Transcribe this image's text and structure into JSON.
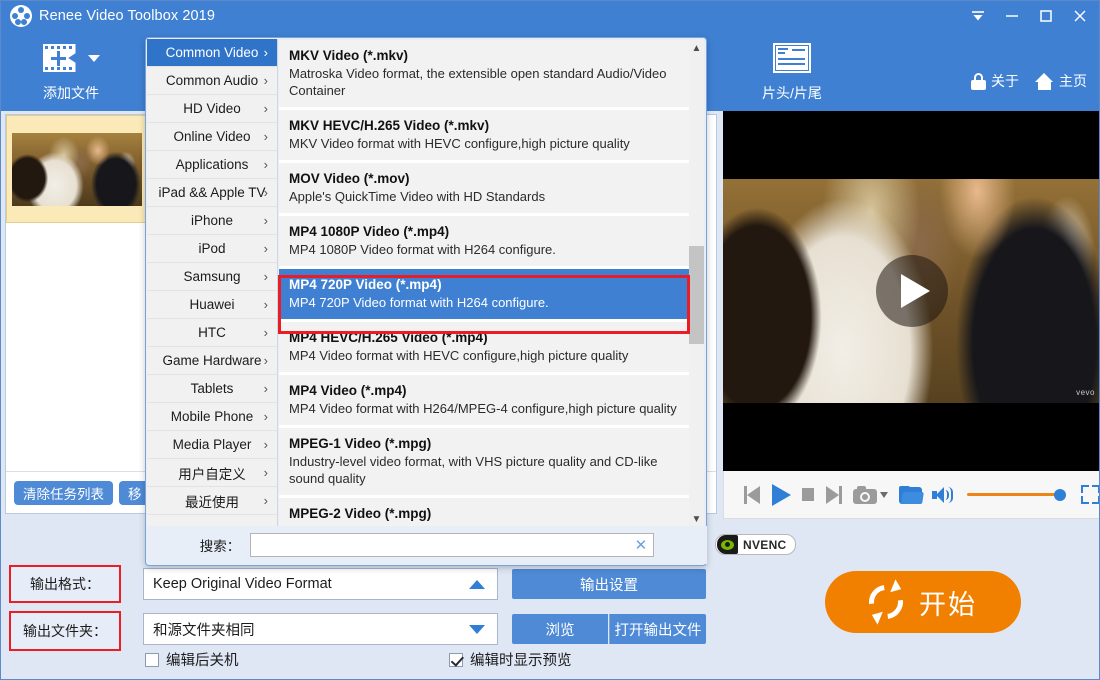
{
  "window": {
    "title": "Renee Video Toolbox 2019",
    "logo_icon": "film-reel-icon",
    "controls": [
      {
        "name": "minimize-to-tray-button",
        "glyph": "tray"
      },
      {
        "name": "minimize-button",
        "glyph": "minimize"
      },
      {
        "name": "maximize-button",
        "glyph": "maximize"
      },
      {
        "name": "close-button",
        "glyph": "close"
      }
    ]
  },
  "toolbar": {
    "add_file_label": "添加文件",
    "add_file_icon": "add-film-icon",
    "trim_label": "片头/片尾",
    "trim_icon": "head-tail-icon",
    "about_label": "关于",
    "about_icon": "lock-icon",
    "home_label": "主页",
    "home_icon": "home-icon"
  },
  "file_list": {
    "clear_button": "清除任务列表",
    "remove_button": "移",
    "items": [
      {
        "name": "wedding-video-thumbnail",
        "selected": true
      }
    ]
  },
  "preview": {
    "play_icon": "play-overlay-icon",
    "watermark": "vevo",
    "controls": [
      {
        "name": "previous-button",
        "icon": "skip-previous-icon"
      },
      {
        "name": "play-button",
        "icon": "play-icon"
      },
      {
        "name": "stop-button",
        "icon": "stop-icon"
      },
      {
        "name": "next-button",
        "icon": "skip-next-icon"
      },
      {
        "name": "snapshot-button",
        "icon": "camera-icon"
      },
      {
        "name": "snapshot-dropdown",
        "icon": "chevron-down-icon"
      },
      {
        "name": "open-folder-button",
        "icon": "folder-icon"
      },
      {
        "name": "volume-button",
        "icon": "speaker-icon"
      },
      {
        "name": "volume-slider",
        "icon": "slider-icon"
      },
      {
        "name": "fullscreen-button",
        "icon": "expand-icon"
      }
    ],
    "volume_percent": 100
  },
  "nvenc": {
    "label": "NVENC",
    "logo_icon": "nvidia-eye-icon"
  },
  "settings": {
    "output_format_label": "输出格式：",
    "output_format_value": "Keep Original Video Format",
    "output_format_caret": "up",
    "output_settings_button": "输出设置",
    "output_folder_label": "输出文件夹：",
    "output_folder_value": "和源文件夹相同",
    "output_folder_caret": "down",
    "browse_button": "浏览",
    "open_output_button": "打开输出文件",
    "shutdown_checkbox_label": "编辑后关机",
    "shutdown_checked": false,
    "preview_checkbox_label": "编辑时显示预览",
    "preview_checked": true,
    "start_button_label": "开始",
    "start_button_icon": "refresh-icon"
  },
  "format_menu": {
    "categories": [
      {
        "label": "Common Video",
        "arrow": "›",
        "active": true
      },
      {
        "label": "Common Audio",
        "arrow": "›",
        "active": false
      },
      {
        "label": "HD Video",
        "arrow": "›",
        "active": false
      },
      {
        "label": "Online Video",
        "arrow": "›",
        "active": false
      },
      {
        "label": "Applications",
        "arrow": "›",
        "active": false
      },
      {
        "label": "iPad && Apple TV",
        "arrow": "›",
        "active": false
      },
      {
        "label": "iPhone",
        "arrow": "›",
        "active": false
      },
      {
        "label": "iPod",
        "arrow": "›",
        "active": false
      },
      {
        "label": "Samsung",
        "arrow": "›",
        "active": false
      },
      {
        "label": "Huawei",
        "arrow": "›",
        "active": false
      },
      {
        "label": "HTC",
        "arrow": "›",
        "active": false
      },
      {
        "label": "Game Hardware",
        "arrow": "›",
        "active": false
      },
      {
        "label": "Tablets",
        "arrow": "›",
        "active": false
      },
      {
        "label": "Mobile Phone",
        "arrow": "›",
        "active": false
      },
      {
        "label": "Media Player",
        "arrow": "›",
        "active": false
      },
      {
        "label": "用户自定义",
        "arrow": "›",
        "active": false
      },
      {
        "label": "最近使用",
        "arrow": "›",
        "active": false
      }
    ],
    "formats": [
      {
        "title": "MKV Video (*.mkv)",
        "desc": "Matroska Video format, the extensible open standard Audio/Video Container",
        "selected": false
      },
      {
        "title": "MKV HEVC/H.265 Video (*.mkv)",
        "desc": "MKV Video format with HEVC configure,high picture quality",
        "selected": false
      },
      {
        "title": "MOV Video (*.mov)",
        "desc": "Apple's QuickTime Video with HD Standards",
        "selected": false
      },
      {
        "title": "MP4 1080P Video (*.mp4)",
        "desc": "MP4 1080P Video format with H264 configure.",
        "selected": false
      },
      {
        "title": "MP4 720P Video (*.mp4)",
        "desc": "MP4 720P Video format with H264 configure.",
        "selected": true
      },
      {
        "title": "MP4 HEVC/H.265 Video (*.mp4)",
        "desc": "MP4 Video format with HEVC configure,high picture quality",
        "selected": false
      },
      {
        "title": "MP4 Video (*.mp4)",
        "desc": "MP4 Video format with H264/MPEG-4 configure,high picture quality",
        "selected": false
      },
      {
        "title": "MPEG-1 Video (*.mpg)",
        "desc": "Industry-level video format, with VHS picture quality and CD-like sound quality",
        "selected": false
      },
      {
        "title": "MPEG-2 Video (*.mpg)",
        "desc": "",
        "selected": false
      }
    ],
    "search_label": "搜索：",
    "search_value": "",
    "search_placeholder": "",
    "search_clear_icon": "clear-icon",
    "scroll_up_icon": "chevron-up-icon",
    "scroll_down_icon": "chevron-down-icon"
  },
  "colors": {
    "accent_blue": "#3f80d3",
    "panel_blue": "#dfe7f5",
    "selection_blue": "#3f80d3",
    "highlight_red": "#ec1c24",
    "start_orange": "#f28000",
    "selected_row_yellow": "#fbeab8",
    "nvidia_green": "#76b900"
  }
}
